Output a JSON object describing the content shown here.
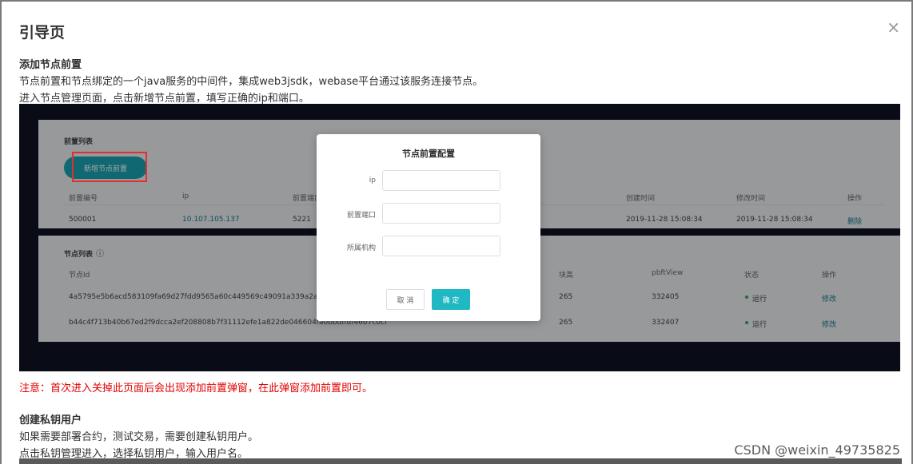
{
  "dialog": {
    "title": "引导页",
    "close_glyph": "×"
  },
  "section1": {
    "heading": "添加节点前置",
    "line1": "节点前置和节点绑定的一个java服务的中间件，集成web3jsdk，webase平台通过该服务连接节点。",
    "line2": "进入节点管理页面，点击新增节点前置，填写正确的ip和端口。"
  },
  "screenshot": {
    "front_list_title": "前置列表",
    "add_front_button": "新增节点前置",
    "front_table": {
      "headers": [
        "前置编号",
        "ip",
        "前置端口",
        "创建时间",
        "修改时间",
        "操作"
      ],
      "row": {
        "id": "500001",
        "ip": "10.107.105.137",
        "port": "5221",
        "created": "2019-11-28 15:08:34",
        "modified": "2019-11-28 15:08:34",
        "action": "删除"
      }
    },
    "node_list_title": "节点列表",
    "node_table": {
      "headers": [
        "节点Id",
        "块高",
        "pbftView",
        "状态",
        "操作"
      ],
      "rows": [
        {
          "id": "4a5795e5b6acd583109fa69d27fdd9565a60c449569c49091a339a2a04cafe08169643b",
          "height": "265",
          "pbft": "332405",
          "status": "运行",
          "action": "修改"
        },
        {
          "id": "b44c4f713b40b67ed2f9dcca2ef208808b7f31112efe1a822de046604fa0bbdffdf46b7c0cf",
          "height": "265",
          "pbft": "332407",
          "status": "运行",
          "action": "修改"
        }
      ]
    },
    "modal": {
      "title": "节点前置配置",
      "ip_label": "ip",
      "port_label": "前置端口",
      "org_label": "所属机构",
      "cancel": "取 消",
      "confirm": "确 定"
    }
  },
  "notice": "注意：首次进入关掉此页面后会出现添加前置弹窗，在此弹窗添加前置即可。",
  "section2": {
    "heading": "创建私钥用户",
    "line1": "如果需要部署合约，测试交易，需要创建私钥用户。",
    "line2": "点击私钥管理进入，选择私钥用户，输入用户名。"
  },
  "watermark": "CSDN @weixin_49735825",
  "colors": {
    "accent": "#19a2b0",
    "notice_red": "#e00000",
    "highlight_red": "#e03030",
    "status_green": "#3aa35a"
  }
}
